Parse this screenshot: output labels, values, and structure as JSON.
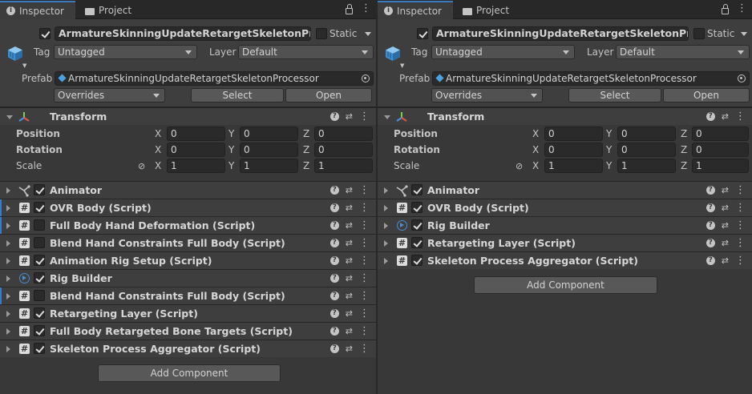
{
  "tabs": {
    "inspector": "Inspector",
    "project": "Project"
  },
  "colors": {
    "accent": "#3a79bb",
    "panel": "#383838",
    "header": "#3e3e3e",
    "field": "#2a2a2a"
  },
  "panels": [
    {
      "id": "left",
      "object_name": "ArmatureSkinningUpdateRetargetSkeletonProcessor",
      "active": true,
      "static_label": "Static",
      "tag_label": "Tag",
      "tag_value": "Untagged",
      "layer_label": "Layer",
      "layer_value": "Default",
      "prefab_label": "Prefab",
      "prefab_value": "ArmatureSkinningUpdateRetargetSkeletonProcessor",
      "overrides": "Overrides",
      "select": "Select",
      "open": "Open",
      "transform": {
        "title": "Transform",
        "position_label": "Position",
        "rotation_label": "Rotation",
        "scale_label": "Scale",
        "position": [
          "0",
          "0",
          "0"
        ],
        "rotation": [
          "0",
          "0",
          "0"
        ],
        "scale": [
          "1",
          "1",
          "1"
        ]
      },
      "components": [
        {
          "title": "Animator",
          "icon": "animator-icon",
          "checked": true,
          "blue": false
        },
        {
          "title": "OVR Body (Script)",
          "icon": "script-icon",
          "checked": true,
          "blue": true
        },
        {
          "title": "Full Body Hand Deformation (Script)",
          "icon": "script-icon",
          "checked": false,
          "blue": true
        },
        {
          "title": "Blend Hand Constraints Full Body (Script)",
          "icon": "script-icon",
          "checked": false,
          "blue": false
        },
        {
          "title": "Animation Rig Setup (Script)",
          "icon": "script-icon",
          "checked": true,
          "blue": false
        },
        {
          "title": "Rig Builder",
          "icon": "rig-icon",
          "checked": true,
          "blue": false
        },
        {
          "title": "Blend Hand Constraints Full Body (Script)",
          "icon": "script-icon",
          "checked": false,
          "blue": true
        },
        {
          "title": "Retargeting Layer (Script)",
          "icon": "script-icon",
          "checked": true,
          "blue": false
        },
        {
          "title": "Full Body Retargeted Bone Targets (Script)",
          "icon": "script-icon",
          "checked": true,
          "blue": false
        },
        {
          "title": "Skeleton Process Aggregator (Script)",
          "icon": "script-icon",
          "checked": true,
          "blue": false
        }
      ],
      "add_component": "Add Component"
    },
    {
      "id": "right",
      "object_name": "ArmatureSkinningUpdateRetargetSkeletonProcessor",
      "active": true,
      "static_label": "Static",
      "tag_label": "Tag",
      "tag_value": "Untagged",
      "layer_label": "Layer",
      "layer_value": "Default",
      "prefab_label": "Prefab",
      "prefab_value": "ArmatureSkinningUpdateRetargetSkeletonProcessor",
      "overrides": "Overrides",
      "select": "Select",
      "open": "Open",
      "transform": {
        "title": "Transform",
        "position_label": "Position",
        "rotation_label": "Rotation",
        "scale_label": "Scale",
        "position": [
          "0",
          "0",
          "0"
        ],
        "rotation": [
          "0",
          "0",
          "0"
        ],
        "scale": [
          "1",
          "1",
          "1"
        ]
      },
      "components": [
        {
          "title": "Animator",
          "icon": "animator-icon",
          "checked": true,
          "blue": false
        },
        {
          "title": "OVR Body (Script)",
          "icon": "script-icon",
          "checked": true,
          "blue": false
        },
        {
          "title": "Rig Builder",
          "icon": "rig-icon",
          "checked": true,
          "blue": false
        },
        {
          "title": "Retargeting Layer (Script)",
          "icon": "script-icon",
          "checked": true,
          "blue": false
        },
        {
          "title": "Skeleton Process Aggregator (Script)",
          "icon": "script-icon",
          "checked": true,
          "blue": false
        }
      ],
      "add_component": "Add Component"
    }
  ],
  "axes": [
    "X",
    "Y",
    "Z"
  ]
}
